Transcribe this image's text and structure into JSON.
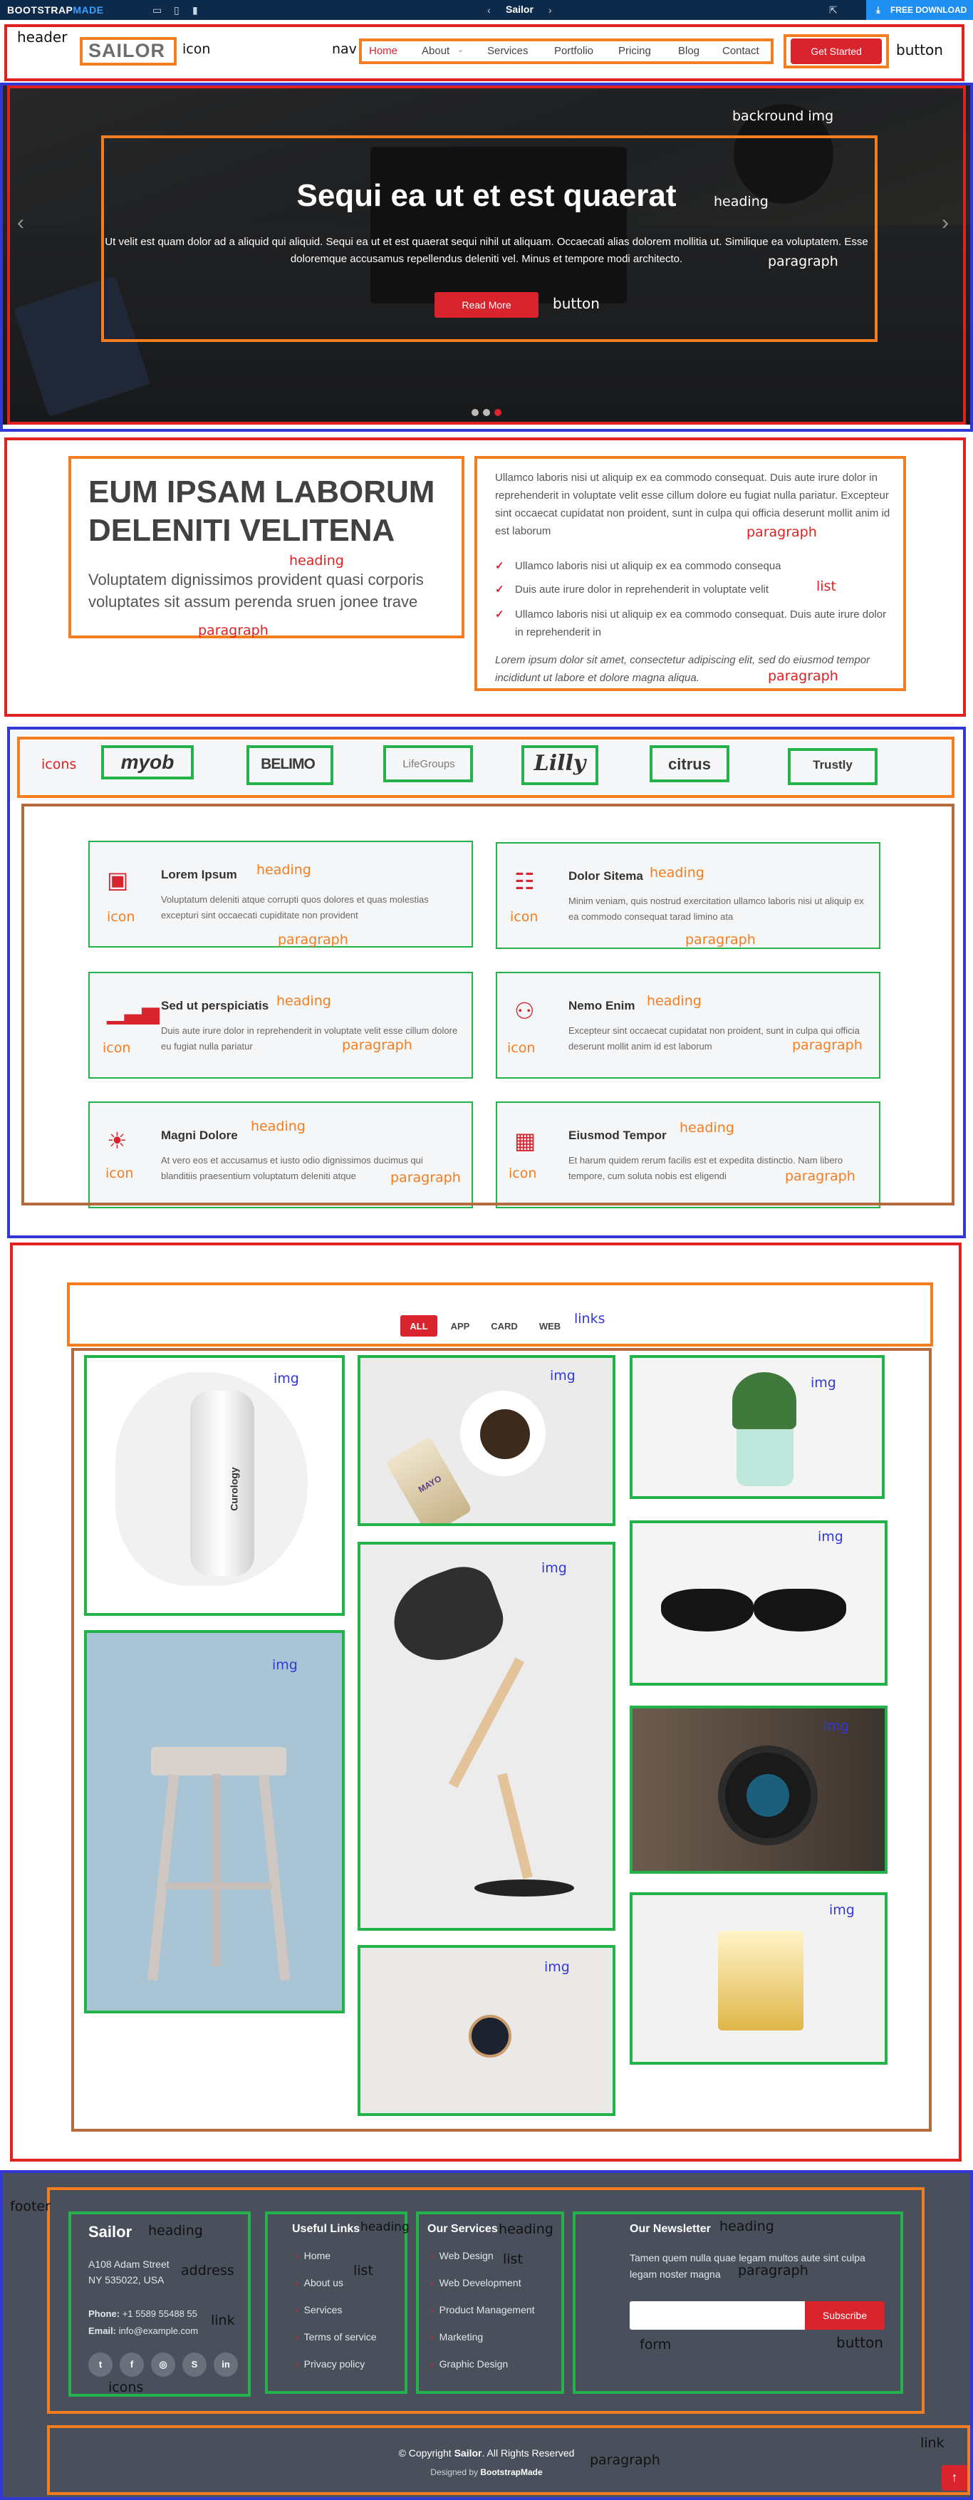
{
  "topbar": {
    "brand_left": "BOOTSTRAP",
    "brand_right": "MADE",
    "template_name": "Sailor",
    "download_label": "FREE DOWNLOAD"
  },
  "header": {
    "logo": "SAILOR",
    "nav": [
      "Home",
      "About",
      "Services",
      "Portfolio",
      "Pricing",
      "Blog",
      "Contact"
    ],
    "cta": "Get Started"
  },
  "hero": {
    "title": "Sequi ea ut et est quaerat",
    "text": "Ut velit est quam dolor ad a aliquid qui aliquid. Sequi ea ut et est quaerat sequi nihil ut aliquam. Occaecati alias dolorem mollitia ut. Similique ea voluptatem. Esse doloremque accusamus repellendus deleniti vel. Minus et tempore modi architecto.",
    "button": "Read More"
  },
  "about": {
    "heading": "EUM IPSAM LABORUM DELENITI VELITENA",
    "lead": "Voluptatem dignissimos provident quasi corporis voluptates sit assum perenda sruen jonee trave",
    "intro": "Ullamco laboris nisi ut aliquip ex ea commodo consequat. Duis aute irure dolor in reprehenderit in voluptate velit esse cillum dolore eu fugiat nulla pariatur. Excepteur sint occaecat cupidatat non proident, sunt in culpa qui officia deserunt mollit anim id est laborum",
    "list": [
      "Ullamco laboris nisi ut aliquip ex ea commodo consequa",
      "Duis aute irure dolor in reprehenderit in voluptate velit",
      "Ullamco laboris nisi ut aliquip ex ea commodo consequat. Duis aute irure dolor in reprehenderit in"
    ],
    "outro": "Lorem ipsum dolor sit amet, consectetur adipiscing elit, sed do eiusmod tempor incididunt ut labore et dolore magna aliqua."
  },
  "clients": [
    "myob",
    "BELIMO",
    "LifeGroups",
    "Lilly",
    "citrus",
    "Trustly"
  ],
  "services": [
    {
      "title": "Lorem Ipsum",
      "text": "Voluptatum deleniti atque corrupti quos dolores et quas molestias excepturi sint occaecati cupiditate non provident",
      "icon": "briefcase-icon"
    },
    {
      "title": "Dolor Sitema",
      "text": "Minim veniam, quis nostrud exercitation ullamco laboris nisi ut aliquip ex ea commodo consequat tarad limino ata",
      "icon": "card-checklist-icon"
    },
    {
      "title": "Sed ut perspiciatis",
      "text": "Duis aute irure dolor in reprehenderit in voluptate velit esse cillum dolore eu fugiat nulla pariatur",
      "icon": "bar-chart-icon"
    },
    {
      "title": "Nemo Enim",
      "text": "Excepteur sint occaecat cupidatat non proident, sunt in culpa qui officia deserunt mollit anim id est laborum",
      "icon": "binoculars-icon"
    },
    {
      "title": "Magni Dolore",
      "text": "At vero eos et accusamus et iusto odio dignissimos ducimus qui blanditiis praesentium voluptatum deleniti atque",
      "icon": "sun-icon"
    },
    {
      "title": "Eiusmod Tempor",
      "text": "Et harum quidem rerum facilis est et expedita distinctio. Nam libero tempore, cum soluta nobis est eligendi",
      "icon": "calendar-icon"
    }
  ],
  "portfolio": {
    "filters": [
      "ALL",
      "APP",
      "CARD",
      "WEB"
    ],
    "bottle_label": "Curology",
    "tube_label": "MAYO"
  },
  "footer": {
    "brand": "Sailor",
    "address_line1": "A108 Adam Street",
    "address_line2": "NY 535022, USA",
    "phone_label": "Phone:",
    "phone": "+1 5589 55488 55",
    "email_label": "Email:",
    "email": "info@example.com",
    "useful_title": "Useful Links",
    "useful_links": [
      "Home",
      "About us",
      "Services",
      "Terms of service",
      "Privacy policy"
    ],
    "services_title": "Our Services",
    "services_links": [
      "Web Design",
      "Web Development",
      "Product Management",
      "Marketing",
      "Graphic Design"
    ],
    "newsletter_title": "Our Newsletter",
    "newsletter_text": "Tamen quem nulla quae legam multos aute sint culpa legam noster magna",
    "subscribe": "Subscribe",
    "copyright_prefix": "© Copyright ",
    "copyright_brand": "Sailor",
    "copyright_suffix": ". All Rights Reserved",
    "credits_prefix": "Designed by ",
    "credits_link": "BootstrapMade"
  },
  "annotations": {
    "header": "header",
    "icon": "icon",
    "nav": "nav",
    "button": "button",
    "background_img": "backround img",
    "heading": "heading",
    "paragraph": "paragraph",
    "list": "list",
    "icons": "icons",
    "links": "links",
    "img": "img",
    "footer": "footer",
    "address": "address",
    "link": "link",
    "form": "form"
  },
  "colors": {
    "accent": "#d9232d",
    "footer_bg": "#49505c",
    "annotation_red": "#e02121",
    "annotation_blue": "#3138d6",
    "annotation_orange": "#f47d20",
    "annotation_green": "#24b24b",
    "annotation_brown": "#b46a3c"
  }
}
